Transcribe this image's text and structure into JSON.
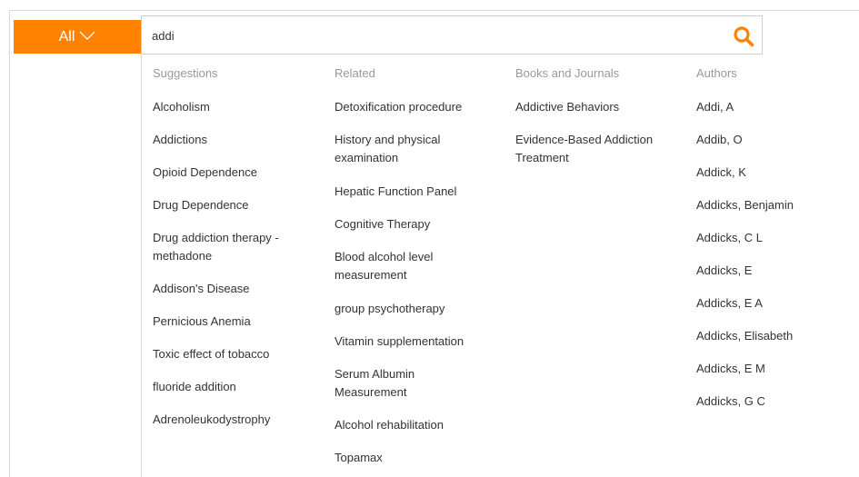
{
  "category_button": {
    "label": "All"
  },
  "search": {
    "value": "addi",
    "icon": "search-icon"
  },
  "colors": {
    "accent": "#ff8200",
    "heading": "#999999",
    "text": "#333333"
  },
  "columns": {
    "suggestions": {
      "heading": "Suggestions",
      "items": [
        "Alcoholism",
        "Addictions",
        "Opioid Dependence",
        "Drug Dependence",
        "Drug addiction therapy - methadone",
        "Addison's Disease",
        "Pernicious Anemia",
        "Toxic effect of tobacco",
        "fluoride addition",
        "Adrenoleukodystrophy"
      ]
    },
    "related": {
      "heading": "Related",
      "items": [
        "Detoxification procedure",
        "History and physical examination",
        "Hepatic Function Panel",
        "Cognitive Therapy",
        "Blood alcohol level measurement",
        "group psychotherapy",
        "Vitamin supplementation",
        "Serum Albumin Measurement",
        "Alcohol rehabilitation",
        "Topamax"
      ]
    },
    "books": {
      "heading": "Books and Journals",
      "items": [
        "Addictive Behaviors",
        "Evidence-Based Addiction Treatment"
      ]
    },
    "authors": {
      "heading": "Authors",
      "items": [
        "Addi, A",
        "Addib, O",
        "Addick, K",
        "Addicks, Benjamin",
        "Addicks, C L",
        "Addicks, E",
        "Addicks, E A",
        "Addicks, Elisabeth",
        "Addicks, E M",
        "Addicks, G C"
      ]
    }
  }
}
